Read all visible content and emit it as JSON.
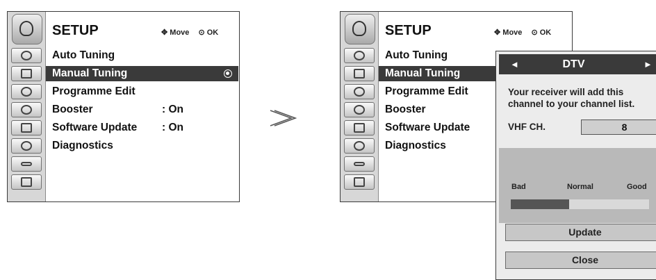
{
  "setup": {
    "title": "SETUP",
    "hint_move": "Move",
    "hint_ok": "OK"
  },
  "left_menu": {
    "items": [
      {
        "label": "Auto Tuning",
        "value": ""
      },
      {
        "label": "Manual Tuning",
        "value": "",
        "selected": true
      },
      {
        "label": "Programme Edit",
        "value": ""
      },
      {
        "label": "Booster",
        "value": ": On"
      },
      {
        "label": "Software Update",
        "value": ": On"
      },
      {
        "label": "Diagnostics",
        "value": ""
      }
    ]
  },
  "right_menu": {
    "items": [
      {
        "label": "Auto Tuning"
      },
      {
        "label": "Manual Tuning",
        "selected": true
      },
      {
        "label": "Programme Edit"
      },
      {
        "label": "Booster"
      },
      {
        "label": "Software Update"
      },
      {
        "label": "Diagnostics"
      }
    ]
  },
  "category_icons": [
    "satellite-dish-icon",
    "screen-icon",
    "speaker-icon",
    "clock-icon",
    "lock-icon",
    "shield-icon",
    "input-plug-icon",
    "settings-icon"
  ],
  "arrow_glyph": ">",
  "popup": {
    "left_arrow": "◄",
    "title": "DTV",
    "right_arrow": "►",
    "message": "Your receiver will add this channel to your channel list.",
    "vhf_label": "VHF CH.",
    "vhf_value": "8",
    "signal_bad": "Bad",
    "signal_normal": "Normal",
    "signal_good": "Good",
    "signal_level": 0.42,
    "update_label": "Update",
    "close_label": "Close"
  },
  "colors": {
    "selected_bg": "#3a3a3a",
    "icon_column": "#d7d7d7",
    "popup_bg": "#ececec",
    "signal_area": "#b9b9b9"
  }
}
